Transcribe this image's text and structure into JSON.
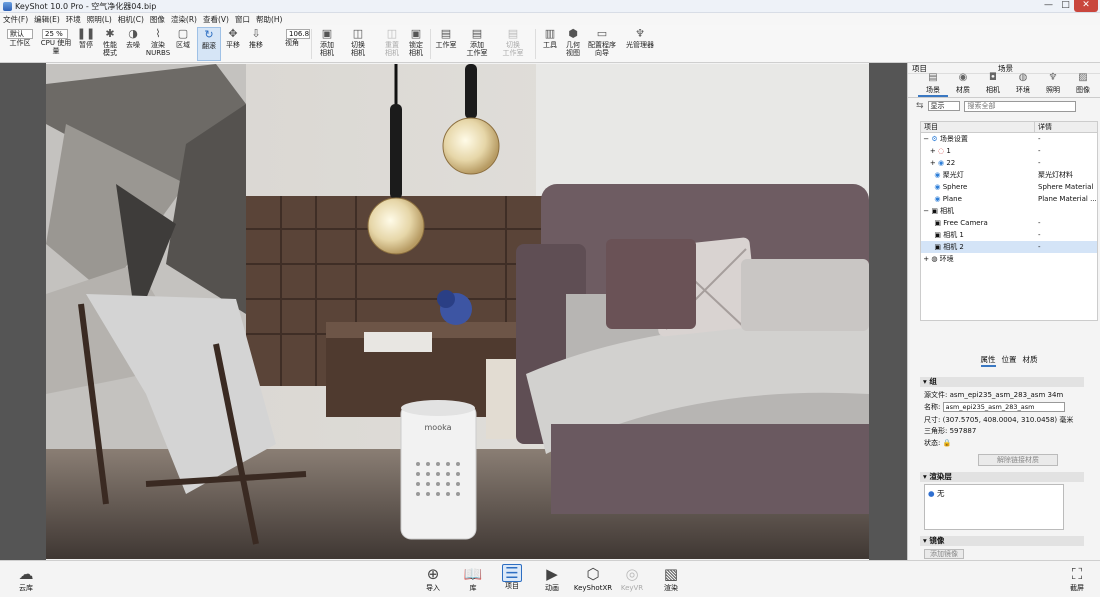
{
  "window": {
    "title": "KeyShot 10.0 Pro  - 空气净化器04.bip",
    "buttons": [
      "—",
      "□",
      "✕"
    ]
  },
  "menu": [
    "文件(F)",
    "编辑(E)",
    "环境",
    "照明(L)",
    "相机(C)",
    "图像",
    "渲染(R)",
    "查看(V)",
    "窗口",
    "帮助(H)"
  ],
  "ribbon": {
    "preset_select": "默认",
    "zoom_select": "25 %",
    "fov_value": "106.8",
    "buttons": [
      {
        "label": "工作区",
        "icon": "▦"
      },
      {
        "label": "CPU 使用量",
        "icon": "▮"
      },
      {
        "label": "暂停",
        "icon": "❚❚"
      },
      {
        "label": "性能\n模式",
        "icon": "✱"
      },
      {
        "label": "去噪",
        "icon": "◑"
      },
      {
        "label": "渲染\nNURBS",
        "icon": "⌇"
      },
      {
        "label": "区域",
        "icon": "▢"
      },
      {
        "label": "翻滚",
        "icon": "↻"
      },
      {
        "label": "平移",
        "icon": "✥"
      },
      {
        "label": "推移",
        "icon": "⇩"
      },
      {
        "label": "视角",
        "icon": "◇"
      },
      {
        "label": "添加\n相机",
        "icon": "▣"
      },
      {
        "label": "切换\n相机",
        "icon": "◫"
      },
      {
        "label": "重置\n相机",
        "icon": "◫"
      },
      {
        "label": "锁定\n相机",
        "icon": "▣"
      },
      {
        "label": "工作室",
        "icon": "▤"
      },
      {
        "label": "添加\n工作室",
        "icon": "▤"
      },
      {
        "label": "切换\n工作室",
        "icon": "▤"
      },
      {
        "label": "工具",
        "icon": "▥"
      },
      {
        "label": "几何\n视图",
        "icon": "⬢"
      },
      {
        "label": "配置程序\n向导",
        "icon": "▭"
      },
      {
        "label": "光管理器",
        "icon": "♆"
      }
    ]
  },
  "panel": {
    "header_left": "项目",
    "header_center": "场景",
    "tabs": [
      {
        "label": "场景",
        "icon": "▤"
      },
      {
        "label": "材质",
        "icon": "◉"
      },
      {
        "label": "相机",
        "icon": "◘"
      },
      {
        "label": "环境",
        "icon": "◍"
      },
      {
        "label": "照明",
        "icon": "♆"
      },
      {
        "label": "图像",
        "icon": "▨"
      }
    ],
    "display_select": "显示",
    "search_placeholder": "搜索全部",
    "tree_headers": [
      "项目",
      "详情"
    ],
    "tree": [
      {
        "name": "场景设置",
        "detail": "-"
      },
      {
        "name": "1",
        "detail": "-"
      },
      {
        "name": "22",
        "detail": "-"
      },
      {
        "name": "聚光灯",
        "detail": "聚光灯材料"
      },
      {
        "name": "Sphere",
        "detail": "Sphere Material"
      },
      {
        "name": "Plane",
        "detail": "Plane Material ..."
      },
      {
        "name": "相机",
        "detail": ""
      },
      {
        "name": "Free Camera",
        "detail": "-"
      },
      {
        "name": "相机 1",
        "detail": "-"
      },
      {
        "name": "相机 2",
        "detail": "-"
      },
      {
        "name": "环境",
        "detail": ""
      }
    ],
    "prop_tabs": [
      "属性",
      "位置",
      "材质"
    ],
    "group_section": "组",
    "source_label": "源文件:",
    "source_value": "asm_epi235_asm_283_asm 34m",
    "name_label": "名称:",
    "name_value": "asm_epi235_asm_283_asm",
    "size_label": "尺寸:",
    "size_value": "(307.5705, 408.0004, 310.0458) 毫米",
    "tris_label": "三角形:",
    "tris_value": "597887",
    "state_label": "状态:",
    "unlink_button": "解除链接材质",
    "render_layer_section": "渲染层",
    "layer_none": "无",
    "mirror_section": "镜像",
    "mirror_button": "添加镜像"
  },
  "bottombar": {
    "cloud": "云库",
    "screenshot": "截屏",
    "items": [
      {
        "label": "导入",
        "icon": "⊕"
      },
      {
        "label": "库",
        "icon": "📖"
      },
      {
        "label": "项目",
        "icon": "☰"
      },
      {
        "label": "动画",
        "icon": "▶"
      },
      {
        "label": "KeyShotXR",
        "icon": "⬡"
      },
      {
        "label": "KeyVR",
        "icon": "◎"
      },
      {
        "label": "渲染",
        "icon": "▧"
      }
    ]
  },
  "viewport": {
    "product_brand": "mooka"
  }
}
